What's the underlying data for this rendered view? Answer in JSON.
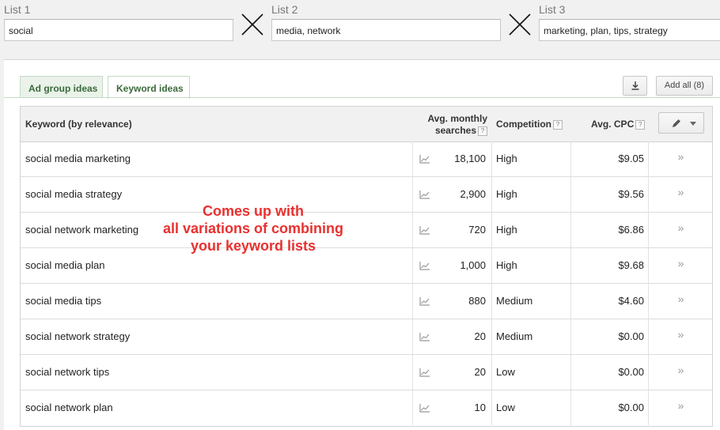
{
  "lists": [
    {
      "label": "List 1",
      "value": "social"
    },
    {
      "label": "List 2",
      "value": "media, network"
    },
    {
      "label": "List 3",
      "value": "marketing, plan, tips, strategy"
    }
  ],
  "tabs": [
    {
      "label": "Ad group ideas"
    },
    {
      "label": "Keyword ideas"
    }
  ],
  "actions": {
    "add_all_label": "Add all (8)"
  },
  "table": {
    "headers": {
      "keyword": "Keyword (by relevance)",
      "searches_line1": "Avg. monthly",
      "searches_line2": "searches",
      "competition": "Competition",
      "cpc": "Avg. CPC",
      "help": "?"
    },
    "rows": [
      {
        "keyword": "social media marketing",
        "searches": "18,100",
        "competition": "High",
        "cpc": "$9.05",
        "add": "»"
      },
      {
        "keyword": "social media strategy",
        "searches": "2,900",
        "competition": "High",
        "cpc": "$9.56",
        "add": "»"
      },
      {
        "keyword": "social network marketing",
        "searches": "720",
        "competition": "High",
        "cpc": "$6.86",
        "add": "»"
      },
      {
        "keyword": "social media plan",
        "searches": "1,000",
        "competition": "High",
        "cpc": "$9.68",
        "add": "»"
      },
      {
        "keyword": "social media tips",
        "searches": "880",
        "competition": "Medium",
        "cpc": "$4.60",
        "add": "»"
      },
      {
        "keyword": "social network strategy",
        "searches": "20",
        "competition": "Medium",
        "cpc": "$0.00",
        "add": "»"
      },
      {
        "keyword": "social network tips",
        "searches": "20",
        "competition": "Low",
        "cpc": "$0.00",
        "add": "»"
      },
      {
        "keyword": "social network plan",
        "searches": "10",
        "competition": "Low",
        "cpc": "$0.00",
        "add": "»"
      }
    ]
  },
  "annotation": {
    "line1": "Comes up with",
    "line2": "all variations of combining",
    "line3": "your keyword lists"
  },
  "colors": {
    "annotation": "#e8312f",
    "tab_text": "#3b6a3b",
    "header_bg": "#f1f1f1"
  },
  "icons": [
    "close-x-icon",
    "download-icon",
    "pencil-icon",
    "dropdown-arrow-icon",
    "trend-chart-icon",
    "add-chevron-icon",
    "help-icon"
  ]
}
